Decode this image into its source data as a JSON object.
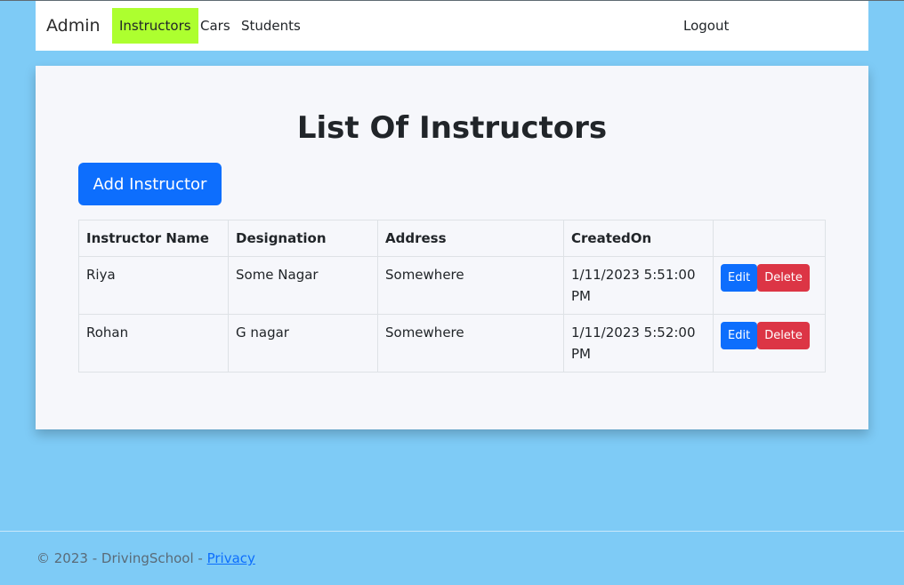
{
  "navbar": {
    "brand": "Admin",
    "links": [
      {
        "label": "Instructors",
        "active": true
      },
      {
        "label": "Cars",
        "active": false
      },
      {
        "label": "Students",
        "active": false
      }
    ],
    "logout_label": "Logout",
    "active_color": "#adff2f"
  },
  "main": {
    "title": "List Of Instructors",
    "add_button_label": "Add Instructor",
    "table": {
      "headers": [
        "Instructor Name",
        "Designation",
        "Address",
        "CreatedOn",
        ""
      ],
      "rows": [
        {
          "name": "Riya",
          "designation": "Some Nagar",
          "address": "Somewhere",
          "created_on": "1/11/2023 5:51:00 PM"
        },
        {
          "name": "Rohan",
          "designation": "G nagar",
          "address": "Somewhere",
          "created_on": "1/11/2023 5:52:00 PM"
        }
      ],
      "edit_label": "Edit",
      "delete_label": "Delete"
    }
  },
  "footer": {
    "text": "© 2023 - DrivingSchool - ",
    "privacy_label": "Privacy"
  },
  "colors": {
    "background": "#7ecbf6",
    "primary": "#0d6efd",
    "danger": "#dc3545"
  }
}
